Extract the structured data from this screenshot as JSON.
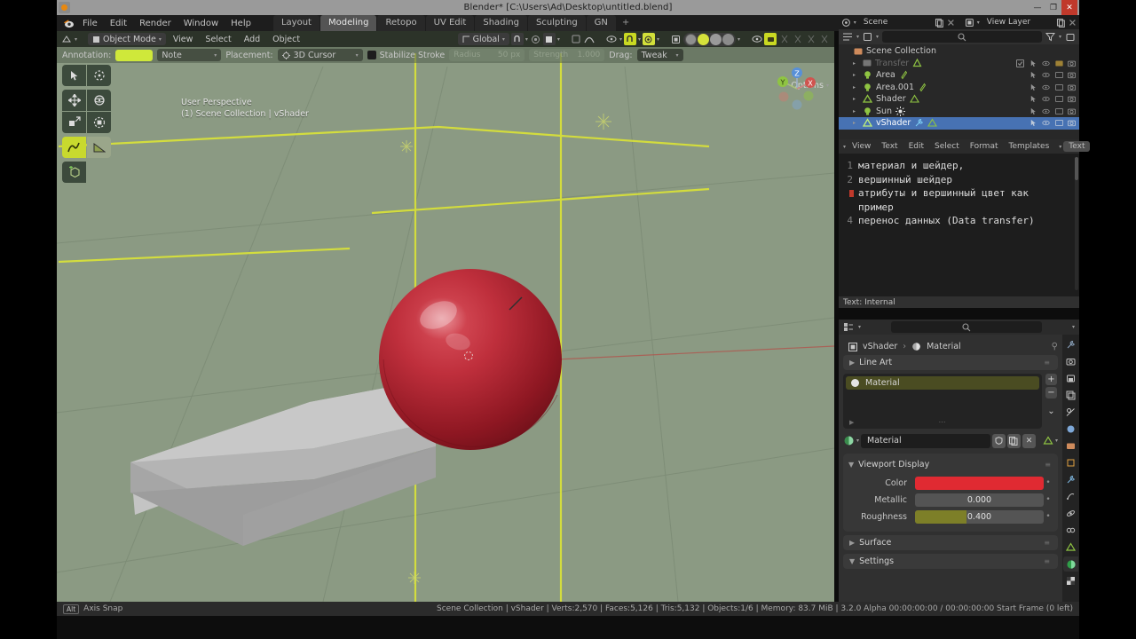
{
  "os": {
    "title": "Blender* [C:\\Users\\Ad\\Desktop\\untitled.blend]",
    "minimize": "—",
    "maximize": "❐",
    "close": "✕"
  },
  "topbar": {
    "menus": [
      "File",
      "Edit",
      "Render",
      "Window",
      "Help"
    ],
    "workspaces": [
      {
        "label": "Layout",
        "active": false
      },
      {
        "label": "Modeling",
        "active": true
      },
      {
        "label": "Retopo",
        "active": false
      },
      {
        "label": "UV Edit",
        "active": false
      },
      {
        "label": "Shading",
        "active": false
      },
      {
        "label": "Sculpting",
        "active": false
      },
      {
        "label": "GN",
        "active": false
      }
    ],
    "add_workspace": "+"
  },
  "viewport": {
    "mode": "Object Mode",
    "menus": [
      "View",
      "Select",
      "Add",
      "Object"
    ],
    "transform_orientation": "Global",
    "annotation_label": "Annotation:",
    "annotation_layer": "Note",
    "placement_label": "Placement:",
    "placement_value": "3D Cursor",
    "stabilize_stroke": "Stabilize Stroke",
    "radius_label": "Radius",
    "radius_value": "50 px",
    "strength_label": "Strength",
    "strength_value": "1.000",
    "drag_label": "Drag:",
    "drag_value": "Tweak",
    "options_label": "Options",
    "overlay_line1": "User Perspective",
    "overlay_line2": "(1) Scene Collection | vShader",
    "gizmo_axes": [
      "Z",
      "Y",
      "X"
    ],
    "tools": [
      {
        "name": "tweak-tool",
        "active": false
      },
      {
        "name": "cursor-tool",
        "active": false
      },
      {
        "name": "move-tool",
        "active": false
      },
      {
        "name": "rotate-tool",
        "active": false
      },
      {
        "name": "scale-tool",
        "active": false
      },
      {
        "name": "transform-tool",
        "active": false
      },
      {
        "name": "annotate-tool",
        "active": true
      },
      {
        "name": "measure-tool",
        "active": false
      },
      {
        "name": "add-cube-tool",
        "active": false
      }
    ]
  },
  "outliner": {
    "scene_name": "Scene",
    "view_layer_name": "View Layer",
    "search_placeholder": "",
    "root": "Scene Collection",
    "items": [
      {
        "label": "Transfer",
        "type": "collection",
        "disabled": true,
        "selected": false,
        "indent": 1
      },
      {
        "label": "Area",
        "type": "light",
        "disabled": false,
        "selected": false,
        "indent": 1
      },
      {
        "label": "Area.001",
        "type": "light",
        "disabled": false,
        "selected": false,
        "indent": 1
      },
      {
        "label": "Shader",
        "type": "mesh",
        "disabled": false,
        "selected": false,
        "indent": 1
      },
      {
        "label": "Sun",
        "type": "light",
        "disabled": false,
        "selected": false,
        "indent": 1
      },
      {
        "label": "vShader",
        "type": "mesh",
        "disabled": false,
        "selected": true,
        "indent": 1
      }
    ]
  },
  "text_editor": {
    "menus": [
      "View",
      "Text",
      "Edit",
      "Select",
      "Format",
      "Templates"
    ],
    "datablock_label": "Text",
    "lines": [
      {
        "num": "1",
        "text": "материал и шейдер,",
        "cursor": false
      },
      {
        "num": "2",
        "text": "вершинный шейдер",
        "cursor": false
      },
      {
        "num": "",
        "text": "атрибуты и вершинный цвет как",
        "cursor": true
      },
      {
        "num": "",
        "text": "пример",
        "cursor": false
      },
      {
        "num": "4",
        "text": "перенос данных (Data transfer)",
        "cursor": false
      }
    ],
    "status": "Text: Internal"
  },
  "properties": {
    "search_placeholder": "",
    "breadcrumb": [
      "vShader",
      "Material"
    ],
    "line_art_panel": "Line Art",
    "material_slot": "Material",
    "slot_add": "+",
    "slot_remove": "−",
    "slot_menu": "⌄",
    "material_name": "Material",
    "viewport_display_panel": "Viewport Display",
    "rows": [
      {
        "label": "Color",
        "value": "",
        "kind": "color",
        "color": "#e02a32",
        "fill": 0
      },
      {
        "label": "Metallic",
        "value": "0.000",
        "kind": "slider",
        "fill": 0
      },
      {
        "label": "Roughness",
        "value": "0.400",
        "kind": "slider",
        "fill": 40
      }
    ],
    "surface_panel": "Surface",
    "settings_panel": "Settings",
    "tabs": [
      {
        "name": "tool-tab",
        "active": false
      },
      {
        "name": "render-tab",
        "active": false
      },
      {
        "name": "output-tab",
        "active": false
      },
      {
        "name": "view-layer-tab",
        "active": false
      },
      {
        "name": "scene-tab",
        "active": false
      },
      {
        "name": "world-tab",
        "active": false
      },
      {
        "name": "collection-tab",
        "active": false
      },
      {
        "name": "object-tab",
        "active": false
      },
      {
        "name": "modifier-tab",
        "active": false
      },
      {
        "name": "particles-tab",
        "active": false
      },
      {
        "name": "physics-tab",
        "active": false
      },
      {
        "name": "constraints-tab",
        "active": false
      },
      {
        "name": "data-tab",
        "active": false
      },
      {
        "name": "material-tab",
        "active": true
      },
      {
        "name": "texture-tab",
        "active": false
      }
    ]
  },
  "statusbar": {
    "key_hint": "Alt",
    "hint_text": "Axis Snap",
    "info": "Scene Collection | vShader | Verts:2,570 | Faces:5,126 | Tris:5,132 | Objects:1/6 | Memory: 83.7 MiB | 3.2.0 Alpha   00:00:00:00 / 00:00:00:00  Start Frame (0 left)"
  },
  "colors": {
    "viewport_bg": "#8b9a83",
    "accent_yellow": "#c9d922",
    "selection_blue": "#4772b3",
    "material_red": "#e02a32",
    "sphere_red": "#b32330"
  }
}
